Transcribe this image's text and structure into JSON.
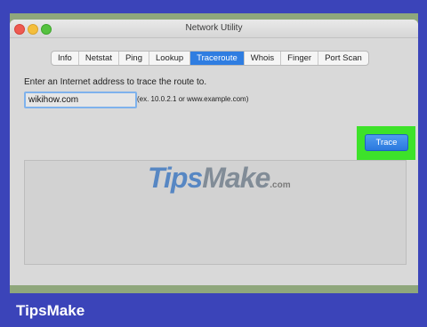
{
  "window": {
    "title": "Network Utility"
  },
  "tabs": [
    {
      "label": "Info",
      "active": false
    },
    {
      "label": "Netstat",
      "active": false
    },
    {
      "label": "Ping",
      "active": false
    },
    {
      "label": "Lookup",
      "active": false
    },
    {
      "label": "Traceroute",
      "active": true
    },
    {
      "label": "Whois",
      "active": false
    },
    {
      "label": "Finger",
      "active": false
    },
    {
      "label": "Port Scan",
      "active": false
    }
  ],
  "traceroute": {
    "prompt": "Enter an Internet address to trace the route to.",
    "address_value": "wikihow.com",
    "example": "(ex. 10.0.2.1 or www.example.com)",
    "trace_label": "Trace",
    "output": ""
  },
  "watermark": {
    "tips": "Tips",
    "make": "Make",
    "suffix": ".com"
  },
  "brand": "TipsMake",
  "colors": {
    "background": "#3b44b9",
    "highlight": "#3de22a",
    "accent": "#2f7de1"
  }
}
